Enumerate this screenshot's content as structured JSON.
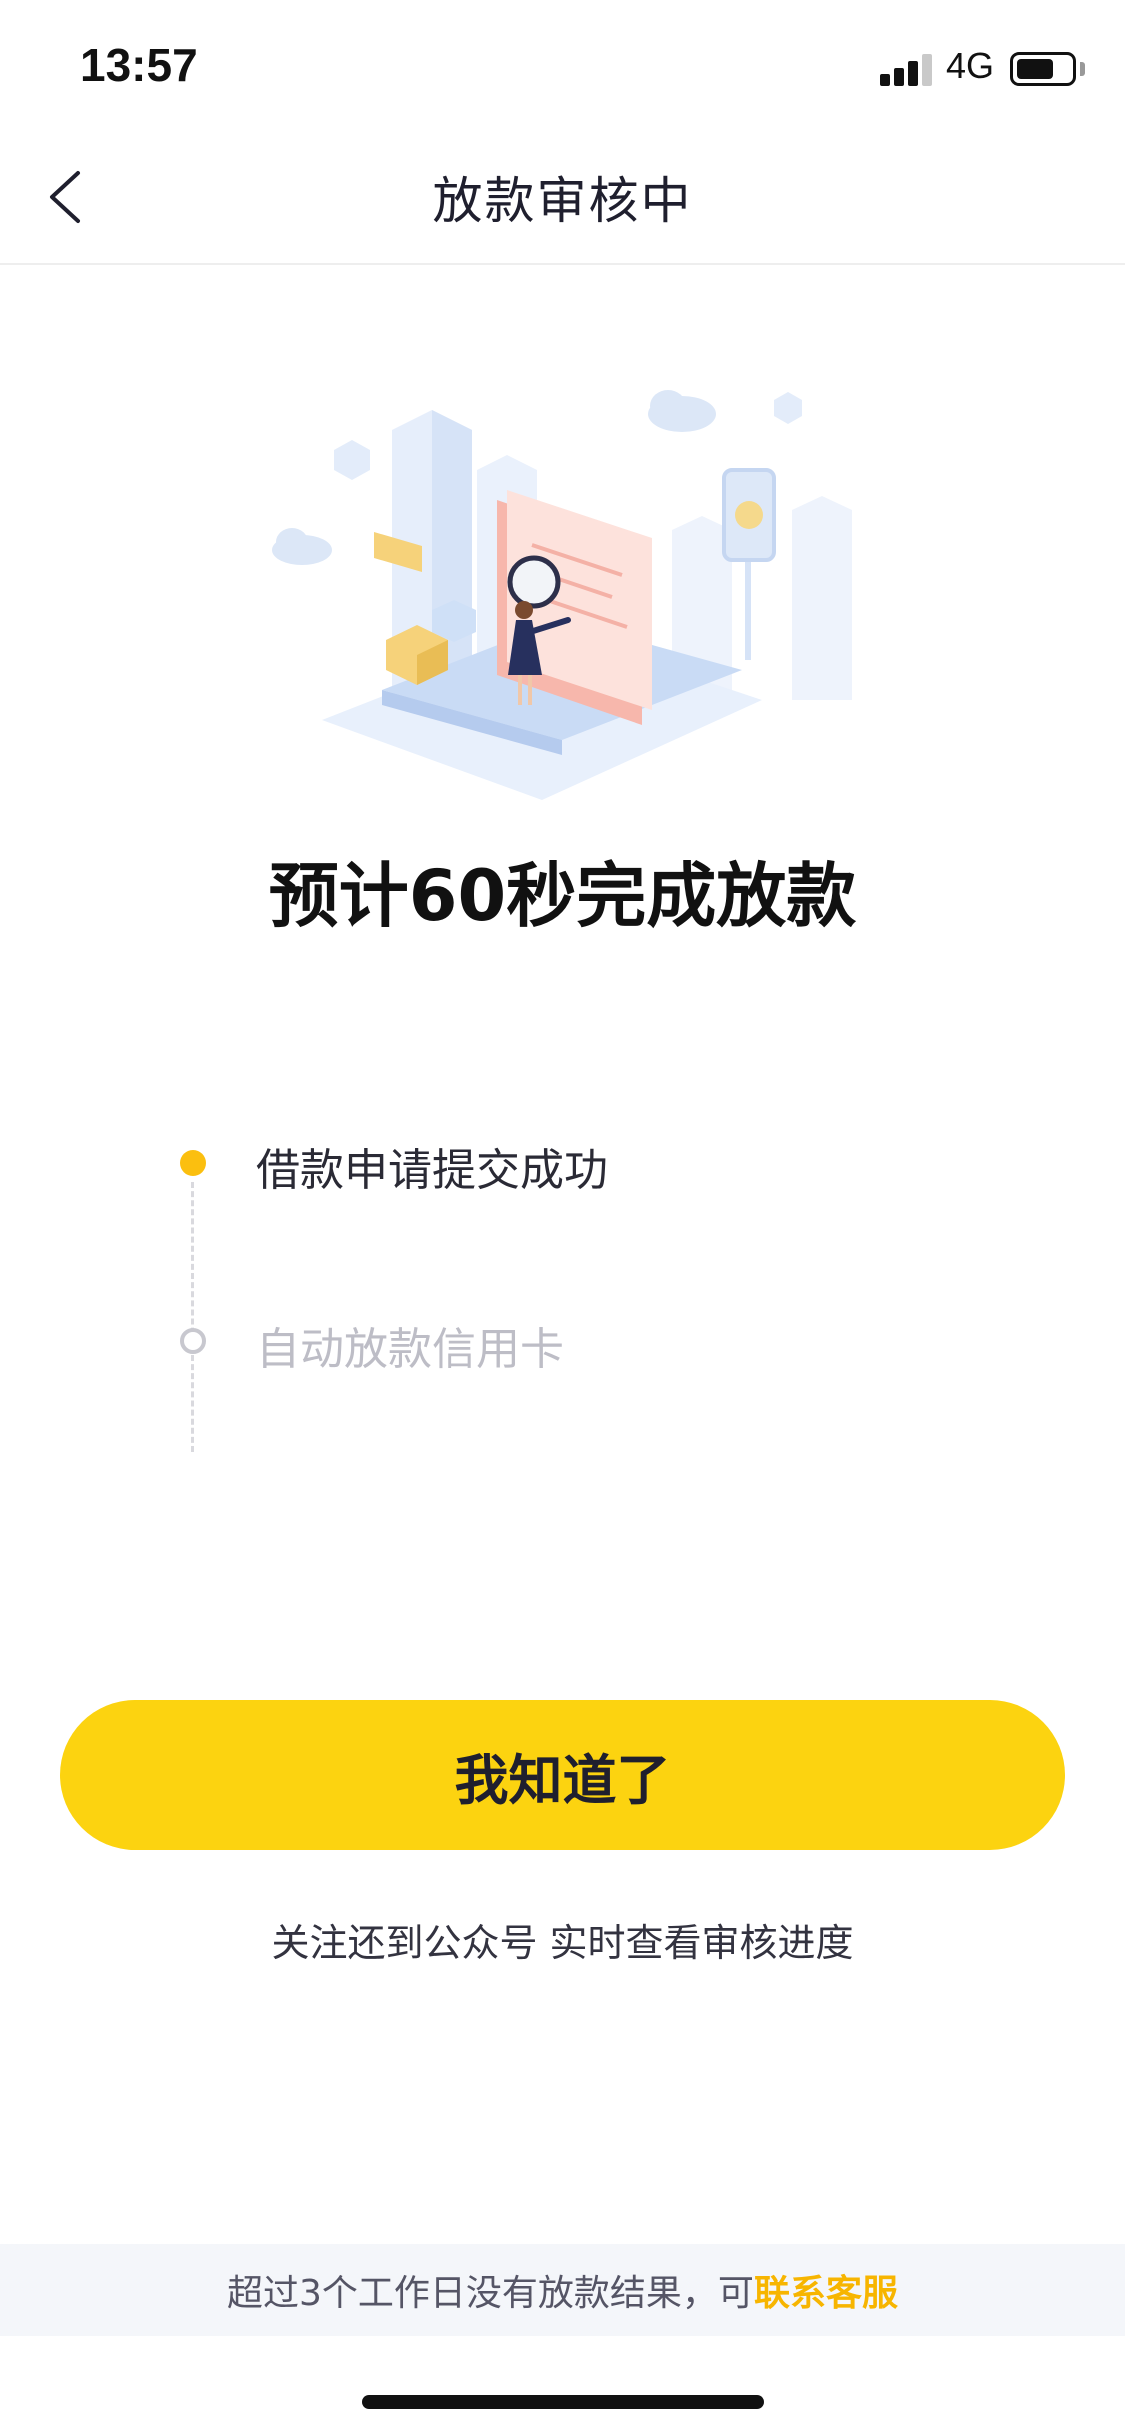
{
  "status_bar": {
    "time": "13:57",
    "network": "4G",
    "signal_icon": "signal-bars-icon",
    "battery_icon": "battery-icon"
  },
  "nav": {
    "back_icon": "chevron-left-icon",
    "title": "放款审核中"
  },
  "illustration": {
    "icon": "loan-review-illustration"
  },
  "headline": "预计60秒完成放款",
  "steps": [
    {
      "label": "借款申请提交成功",
      "state": "done"
    },
    {
      "label": "自动放款信用卡",
      "state": "pending"
    }
  ],
  "primary_button": {
    "label": "我知道了"
  },
  "follow_tip": "关注还到公众号 实时查看审核进度",
  "footer": {
    "text": "超过3个工作日没有放款结果，可",
    "link_label": "联系客服"
  },
  "colors": {
    "accent_yellow": "#fcd310",
    "link_orange": "#f7b500",
    "step_active": "#fbbf0f"
  }
}
